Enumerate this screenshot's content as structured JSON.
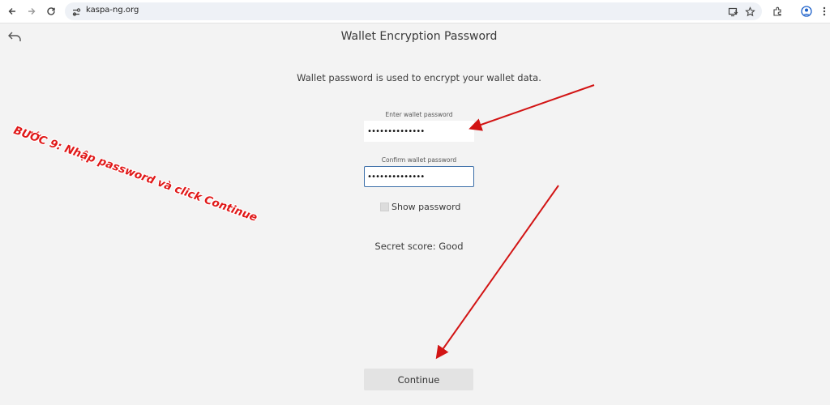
{
  "browser": {
    "url": "kaspa-ng.org"
  },
  "page": {
    "title": "Wallet Encryption Password",
    "description": "Wallet password is used to encrypt your wallet data.",
    "password_label": "Enter wallet password",
    "password_value": "••••••••••••••",
    "confirm_label": "Confirm wallet password",
    "confirm_value": "••••••••••••••",
    "show_password_label": "Show password",
    "secret_score": "Secret score: Good",
    "continue_label": "Continue"
  },
  "annotation": {
    "text": "BƯỚC 9: Nhập password và click Continue",
    "color": "#e01818"
  },
  "colors": {
    "accent_focus": "#3b6ea8",
    "page_bg": "#f3f3f3"
  }
}
